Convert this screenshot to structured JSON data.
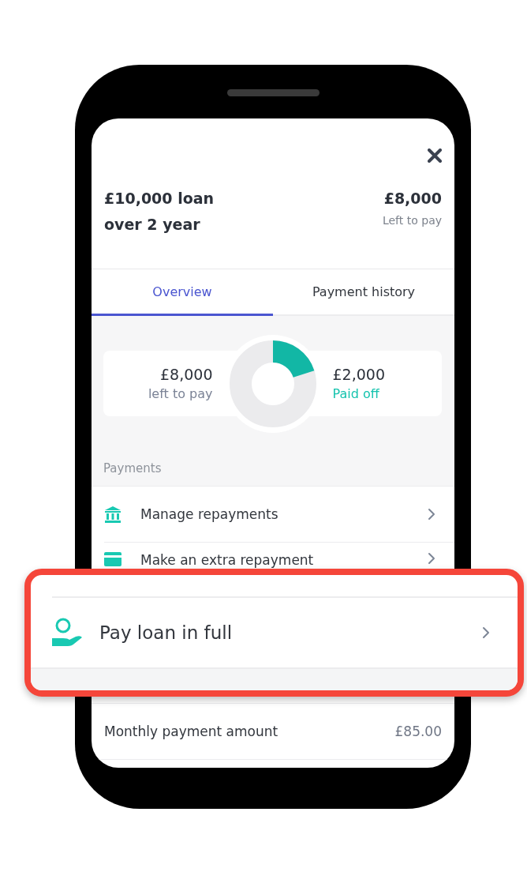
{
  "header": {
    "title_lines": [
      "£10,000 loan",
      "over 2 year"
    ],
    "amount": "£8,000",
    "amount_label": "Left to pay"
  },
  "tabs": [
    {
      "label": "Overview",
      "selected": true
    },
    {
      "label": "Payment history",
      "selected": false
    }
  ],
  "summary": {
    "left_amount": "£8,000",
    "left_label": "left to pay",
    "paid_amount": "£2,000",
    "paid_label": "Paid off",
    "level": 0.2
  },
  "payments": {
    "heading": "Payments",
    "items": [
      {
        "label": "Manage repayments",
        "kind": "bank"
      },
      {
        "label": "Make an extra repayment",
        "kind": "card"
      }
    ]
  },
  "callout": {
    "label": "Pay loan in full",
    "kind": "hand"
  },
  "details": [
    {
      "label": "Monthly payment amount",
      "value": "£85.00"
    }
  ]
}
